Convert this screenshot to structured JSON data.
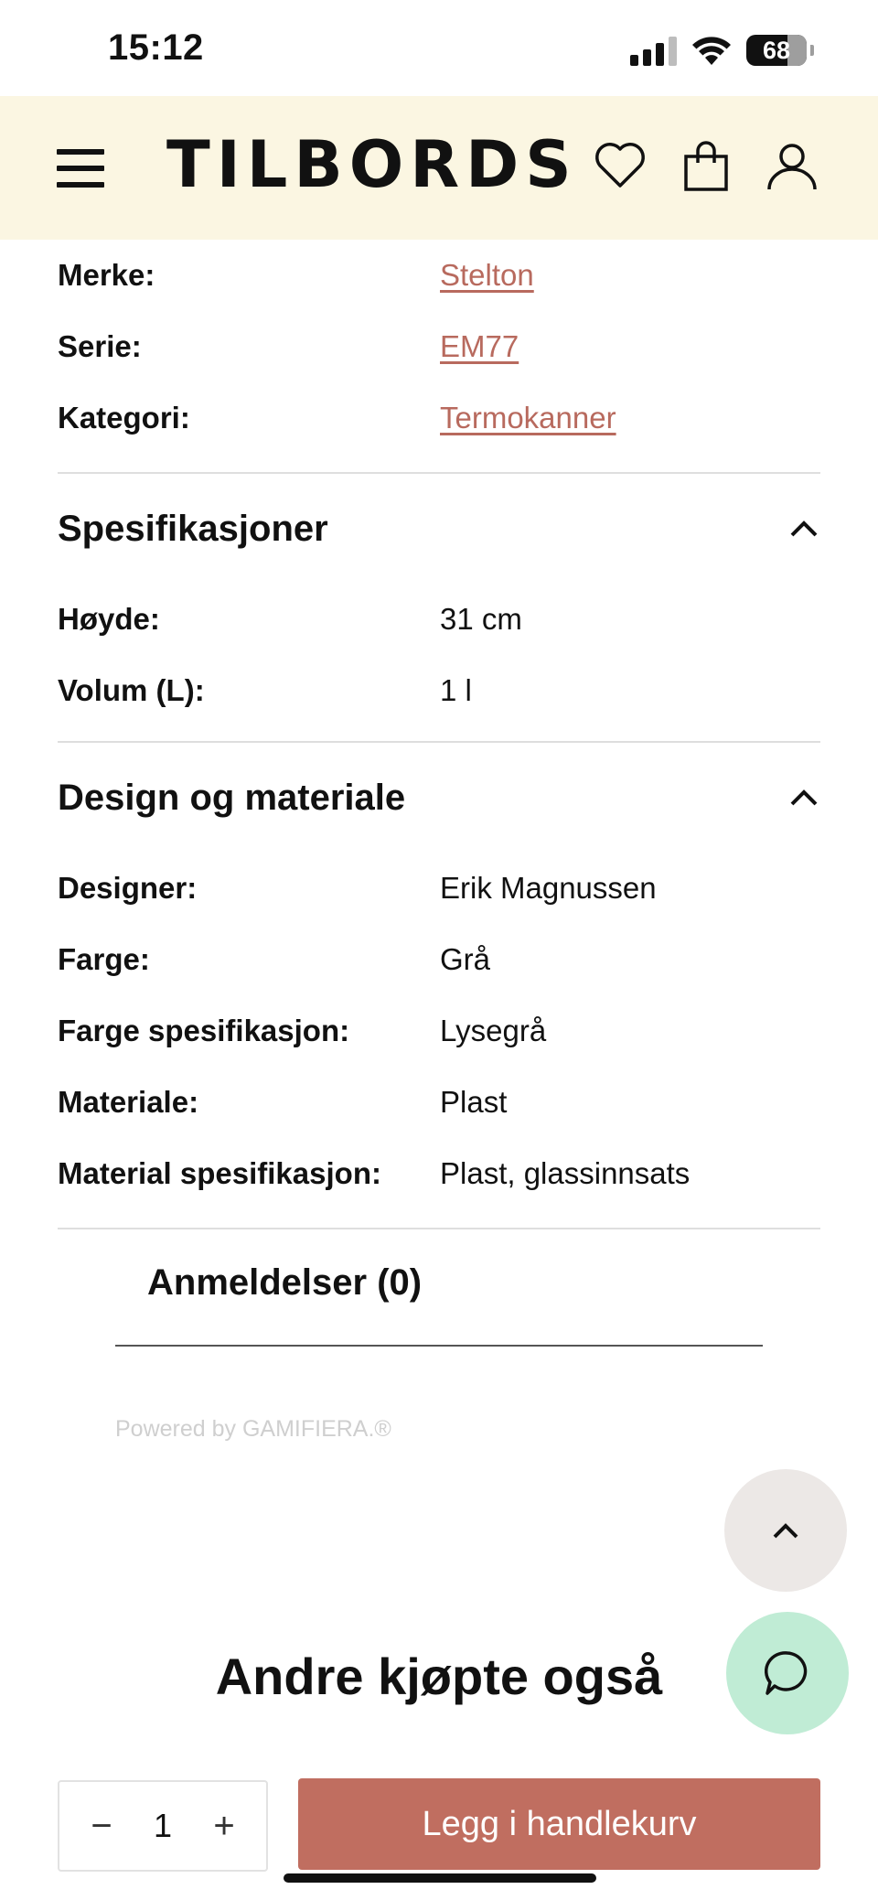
{
  "status_bar": {
    "time": "15:12",
    "battery": "68"
  },
  "header": {
    "logo": "TILBORDS"
  },
  "product_info": [
    {
      "label": "Merke:",
      "value": "Stelton"
    },
    {
      "label": "Serie:",
      "value": "EM77"
    },
    {
      "label": "Kategori:",
      "value": "Termokanner"
    }
  ],
  "specifications": {
    "title": "Spesifikasjoner",
    "rows": [
      {
        "label": "Høyde:",
        "value": "31 cm"
      },
      {
        "label": "Volum (L):",
        "value": "1 l"
      }
    ]
  },
  "design": {
    "title": "Design og materiale",
    "rows": [
      {
        "label": "Designer:",
        "value": "Erik Magnussen"
      },
      {
        "label": "Farge:",
        "value": "Grå"
      },
      {
        "label": "Farge spesifikasjon:",
        "value": "Lysegrå"
      },
      {
        "label": "Materiale:",
        "value": "Plast"
      },
      {
        "label": "Material spesifikasjon:",
        "value": "Plast, glassinnsats"
      }
    ]
  },
  "reviews": {
    "title": "Anmeldelser (0)",
    "powered_by": "Powered by GAMIFIERA.®"
  },
  "also_bought": {
    "title": "Andre kjøpte også"
  },
  "cart_bar": {
    "minus": "−",
    "quantity": "1",
    "plus": "+",
    "add_label": "Legg i handlekurv"
  },
  "colors": {
    "header_bg": "#fbf6e2",
    "link": "#b86a5e",
    "cart_button": "#c06e60",
    "chat_button": "#c0ecd5"
  }
}
